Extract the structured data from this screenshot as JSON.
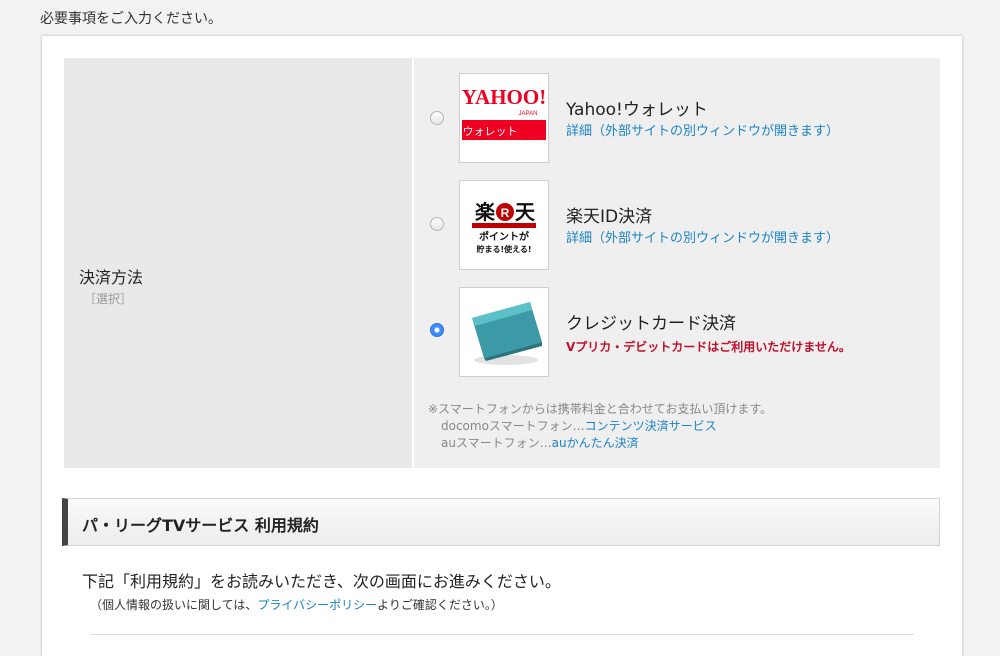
{
  "intro": "必要事項をご入力ください。",
  "field": {
    "label": "決済方法",
    "required": "［選択］"
  },
  "options": [
    {
      "title": "Yahoo!ウォレット",
      "link": "詳細（外部サイトの別ウィンドウが開きます）",
      "logo": {
        "brand": "YAHOO!",
        "sub": "JAPAN",
        "band": "ウォレット"
      },
      "selected": false
    },
    {
      "title": "楽天ID決済",
      "link": "詳細（外部サイトの別ウィンドウが開きます）",
      "logo": {
        "brand_a": "楽",
        "brand_r": "R",
        "brand_b": "天",
        "line1": "ポイントが",
        "line2": "貯まる!使える!"
      },
      "selected": false
    },
    {
      "title": "クレジットカード決済",
      "warning": "Vプリカ・デビットカードはご利用いただけません。",
      "selected": true
    }
  ],
  "note": {
    "line1": "※スマートフォンからは携帯料金と合わせてお支払い頂けます。",
    "docomo_prefix": "docomoスマートフォン…",
    "docomo_link": "コンテンツ決済サービス",
    "au_prefix": "auスマートフォン…",
    "au_link": "auかんたん決済"
  },
  "section": {
    "title": "パ・リーグTVサービス 利用規約"
  },
  "body": {
    "text": "下記「利用規約」をお読みいただき、次の画面にお進みください。",
    "sub_prefix": "（個人情報の扱いに関しては、",
    "sub_link": "プライバシーポリシー",
    "sub_suffix": "よりご確認ください。）"
  },
  "colors": {
    "link": "#1a83c6",
    "warning": "#c0112b",
    "yahoo_red": "#ee0022"
  }
}
